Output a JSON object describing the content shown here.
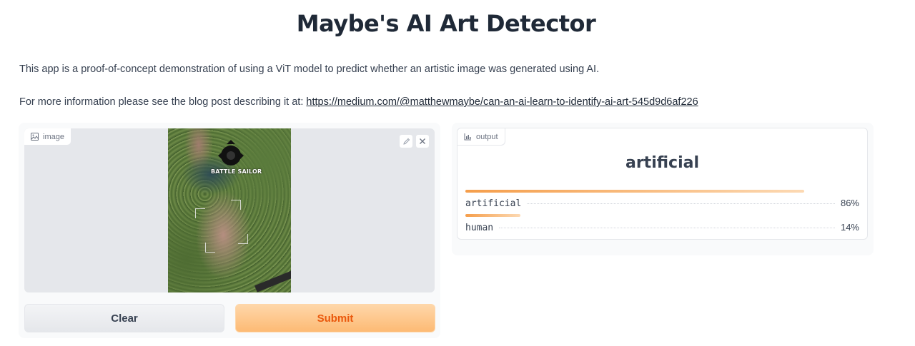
{
  "page": {
    "title": "Maybe's AI Art Detector",
    "description": "This app is a proof-of-concept demonstration of using a ViT model to predict whether an artistic image was generated using AI.",
    "more_info_prefix": "For more information please see the blog post describing it at: ",
    "blog_link": "https://medium.com/@matthewmaybe/can-an-ai-learn-to-identify-ai-art-545d9d6af226"
  },
  "input": {
    "label": "image",
    "label_icon": "image-icon",
    "edit_icon": "pencil-icon",
    "close_icon": "close-icon",
    "image_watermark": "BATTLE SAILOR"
  },
  "buttons": {
    "clear": "Clear",
    "submit": "Submit"
  },
  "output": {
    "label": "output",
    "label_icon": "bar-chart-icon",
    "prediction": "artificial",
    "confidences": [
      {
        "label": "artificial",
        "value": 0.86,
        "display": "86%"
      },
      {
        "label": "human",
        "value": 0.14,
        "display": "14%"
      }
    ]
  },
  "colors": {
    "accent": "#f97316",
    "submit_text": "#ea580c",
    "bar": "#f59e4b"
  }
}
